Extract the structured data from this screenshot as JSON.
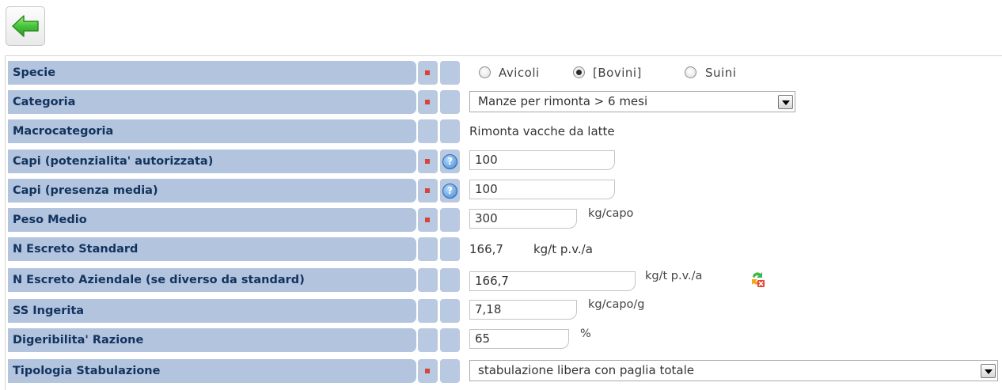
{
  "toolbar": {
    "back_icon": "green-left-arrow-icon"
  },
  "rows": [
    {
      "label": "Specie",
      "required": true,
      "help": false,
      "options": [
        "Avicoli",
        "[Bovini]",
        "Suini"
      ],
      "selected": "[Bovini]"
    },
    {
      "label": "Categoria",
      "required": true,
      "help": false,
      "select_value": "Manze per rimonta > 6 mesi"
    },
    {
      "label": "Macrocategoria",
      "required": false,
      "help": false,
      "value": "Rimonta vacche da latte"
    },
    {
      "label": "Capi (potenzialita' autorizzata)",
      "required": true,
      "help": true,
      "input_value": "100"
    },
    {
      "label": "Capi (presenza media)",
      "required": true,
      "help": true,
      "input_value": "100"
    },
    {
      "label": "Peso Medio",
      "required": true,
      "help": false,
      "input_value": "300",
      "unit": "kg/capo"
    },
    {
      "label": "N Escreto Standard",
      "required": false,
      "help": false,
      "value": "166,7",
      "unit": "kg/t p.v./a"
    },
    {
      "label": "N Escreto Aziendale (se diverso da standard)",
      "required": false,
      "help": false,
      "input_value": "166,7",
      "unit": "kg/t p.v./a",
      "action_icon": "recalculate-icon"
    },
    {
      "label": "SS Ingerita",
      "required": false,
      "help": false,
      "input_value": "7,18",
      "unit": "kg/capo/g"
    },
    {
      "label": "Digeribilita' Razione",
      "required": false,
      "help": false,
      "input_value": "65",
      "unit": "%"
    },
    {
      "label": "Tipologia Stabulazione",
      "required": true,
      "help": false,
      "select_value": "stabulazione libera con paglia totale"
    }
  ],
  "help_glyph": "?",
  "colors": {
    "label_bg": "#b2c4de",
    "label_text": "#12335e",
    "required_marker": "#d9433a",
    "back_arrow": "#3fb53a"
  }
}
